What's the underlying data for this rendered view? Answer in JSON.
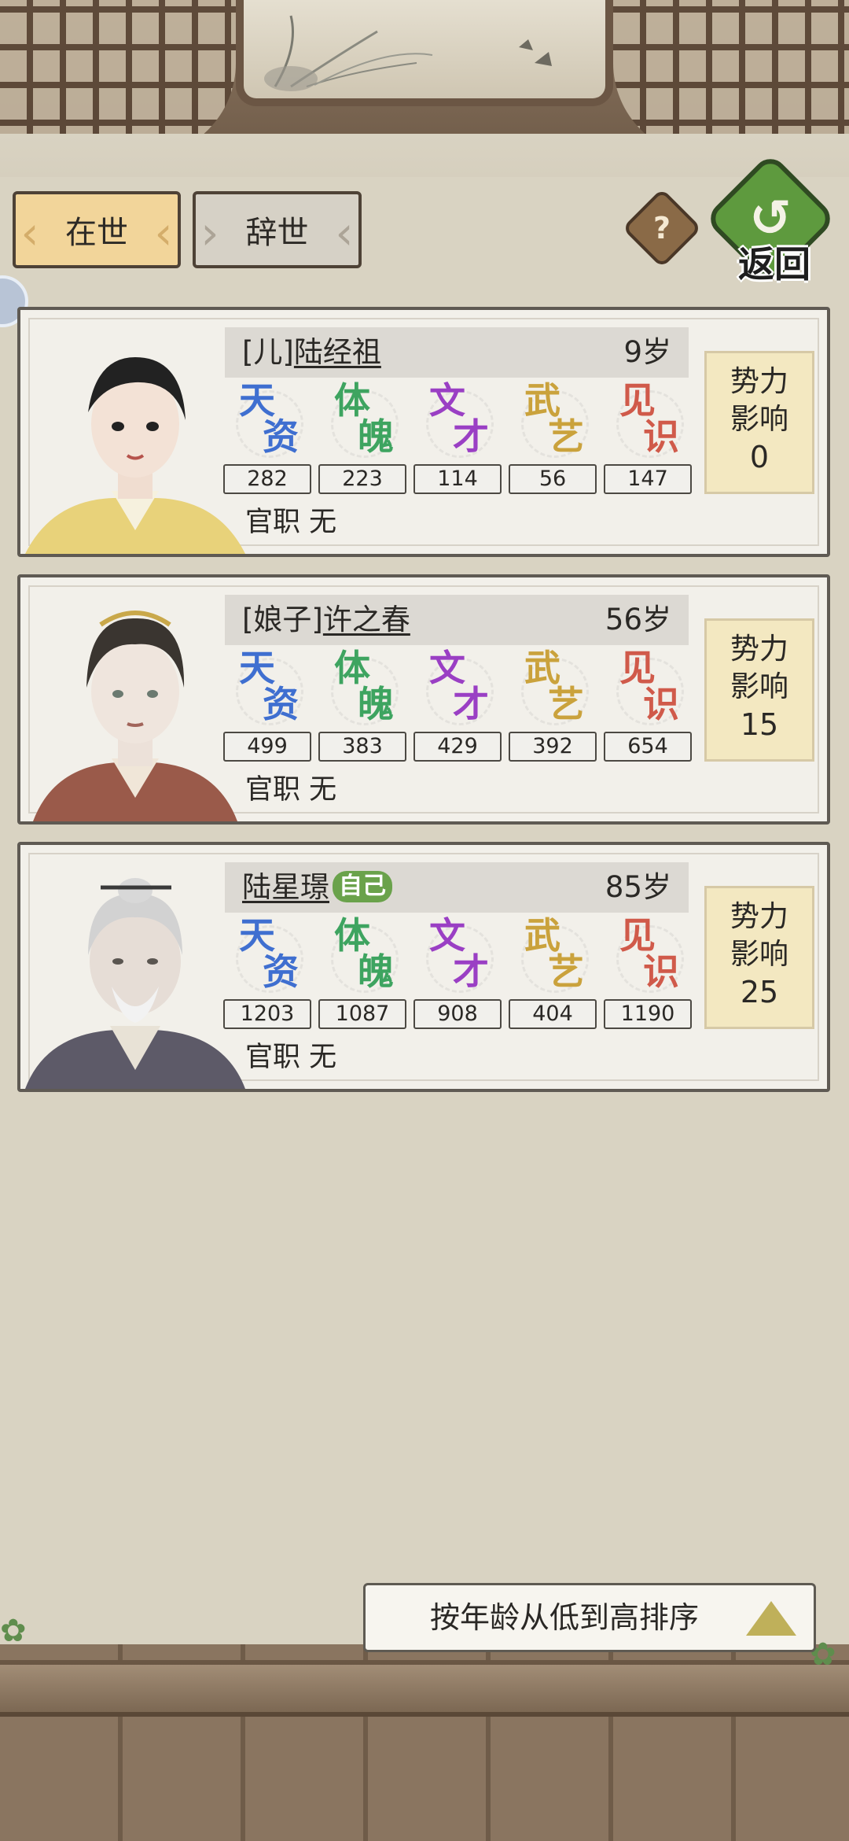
{
  "tabs": {
    "alive": "在世",
    "deceased": "辞世"
  },
  "header": {
    "help_symbol": "?",
    "back_label": "返回",
    "back_symbol": "↺"
  },
  "members": [
    {
      "relation": "[儿]",
      "name": "陆经祖",
      "self_tag": "",
      "age": "9岁",
      "stats": [
        {
          "g1": "天",
          "g2": "资",
          "value": "282",
          "color": "#3f6fd0"
        },
        {
          "g1": "体",
          "g2": "魄",
          "value": "223",
          "color": "#3ea460"
        },
        {
          "g1": "文",
          "g2": "才",
          "value": "114",
          "color": "#9a3fc4"
        },
        {
          "g1": "武",
          "g2": "艺",
          "value": "56",
          "color": "#caa23c"
        },
        {
          "g1": "见",
          "g2": "识",
          "value": "147",
          "color": "#d05a4a"
        }
      ],
      "office": "官职 无",
      "influence": {
        "l1": "势力",
        "l2": "影响",
        "value": "0"
      }
    },
    {
      "relation": "[娘子]",
      "name": "许之春",
      "self_tag": "",
      "age": "56岁",
      "stats": [
        {
          "g1": "天",
          "g2": "资",
          "value": "499",
          "color": "#3f6fd0"
        },
        {
          "g1": "体",
          "g2": "魄",
          "value": "383",
          "color": "#3ea460"
        },
        {
          "g1": "文",
          "g2": "才",
          "value": "429",
          "color": "#9a3fc4"
        },
        {
          "g1": "武",
          "g2": "艺",
          "value": "392",
          "color": "#caa23c"
        },
        {
          "g1": "见",
          "g2": "识",
          "value": "654",
          "color": "#d05a4a"
        }
      ],
      "office": "官职 无",
      "influence": {
        "l1": "势力",
        "l2": "影响",
        "value": "15"
      }
    },
    {
      "relation": "",
      "name": "陆星璟",
      "self_tag": "自己",
      "age": "85岁",
      "stats": [
        {
          "g1": "天",
          "g2": "资",
          "value": "1203",
          "color": "#3f6fd0"
        },
        {
          "g1": "体",
          "g2": "魄",
          "value": "1087",
          "color": "#3ea460"
        },
        {
          "g1": "文",
          "g2": "才",
          "value": "908",
          "color": "#9a3fc4"
        },
        {
          "g1": "武",
          "g2": "艺",
          "value": "404",
          "color": "#caa23c"
        },
        {
          "g1": "见",
          "g2": "识",
          "value": "1190",
          "color": "#d05a4a"
        }
      ],
      "office": "官职 无",
      "influence": {
        "l1": "势力",
        "l2": "影响",
        "value": "25"
      }
    }
  ],
  "sort": {
    "label": "按年龄从低到高排序"
  }
}
